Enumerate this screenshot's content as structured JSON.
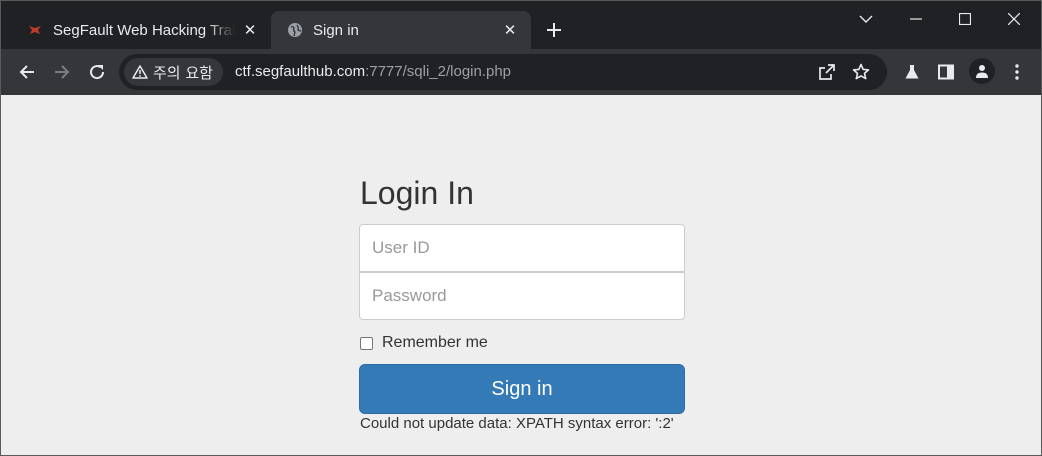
{
  "tabs": [
    {
      "title": "SegFault Web Hacking Trai",
      "active": false,
      "favicon": "segfault-logo-icon"
    },
    {
      "title": "Sign in",
      "active": true,
      "favicon": "globe-icon"
    }
  ],
  "window_controls": [
    "tab-search-icon",
    "minimize-icon",
    "maximize-icon",
    "close-window-icon"
  ],
  "toolbar": {
    "security_label": "주의 요함",
    "url_host": "ctf.segfaulthub.com",
    "url_rest": ":7777/sqli_2/login.php",
    "icons": [
      "back-icon",
      "forward-icon",
      "reload-icon",
      "share-icon",
      "bookmark-star-icon",
      "labs-flask-icon",
      "side-panel-icon",
      "profile-icon",
      "menu-icon"
    ]
  },
  "colors": {
    "accent": "#337ab7",
    "page_bg": "#eeeeee",
    "chrome_dark": "#202124",
    "chrome_toolbar": "#35363a"
  },
  "login": {
    "heading": "Login In",
    "userid_placeholder": "User ID",
    "password_placeholder": "Password",
    "remember_label": "Remember me",
    "signin_label": "Sign in",
    "error_message": "Could not update data: XPATH syntax error: ':2'"
  }
}
